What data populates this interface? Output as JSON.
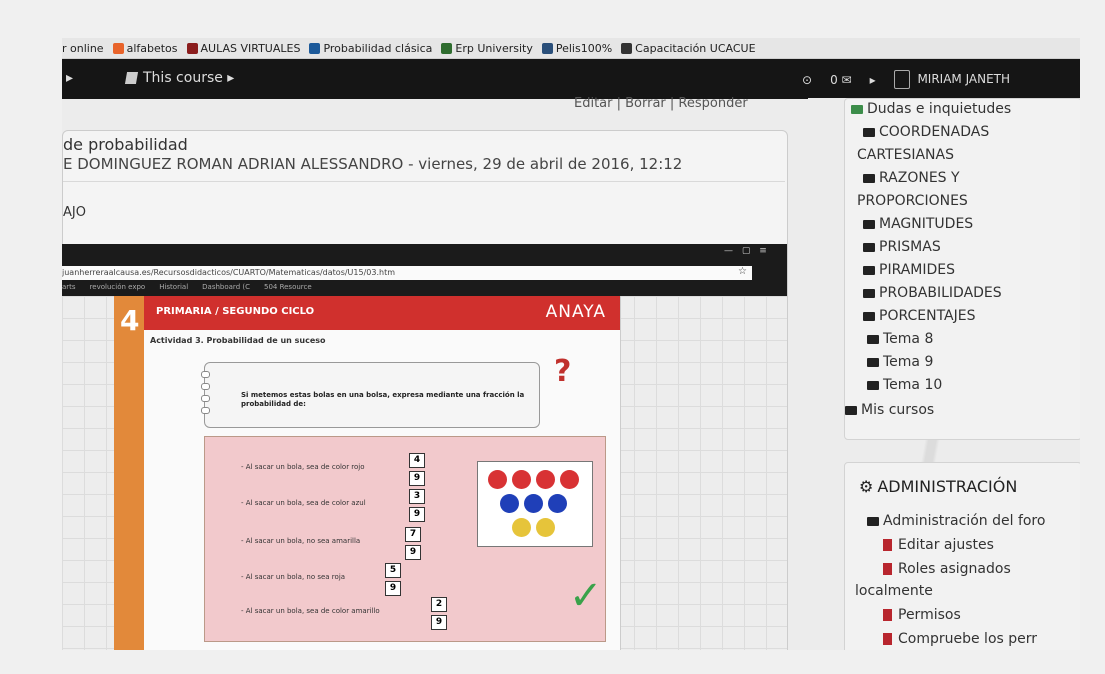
{
  "bookmarks": [
    {
      "label": "r online",
      "icon": "none",
      "color": ""
    },
    {
      "label": "alfabetos",
      "icon": "blogger-icon",
      "color": "#e8632a"
    },
    {
      "label": "AULAS VIRTUALES",
      "icon": "m-logo-icon",
      "color": "#8b1d1d"
    },
    {
      "label": "Probabilidad clásica",
      "icon": "linkedin-icon",
      "color": "#1d5a9a"
    },
    {
      "label": "Erp University",
      "icon": "globe-icon",
      "color": "#2f6d2f"
    },
    {
      "label": "Pelis100%",
      "icon": "tv-icon",
      "color": "#2a4f7a"
    },
    {
      "label": "Capacitación UCACUE",
      "icon": "person-icon",
      "color": "#333333"
    }
  ],
  "topnav": {
    "chevron": "▸",
    "course_label": "This course ▸",
    "power": "⊙",
    "messages": "0 ✉",
    "arrow": "▸",
    "user_name": "MIRIAM JANETH"
  },
  "post": {
    "actions": "Editar | Borrar | Responder",
    "title": "de probabilidad",
    "author_line": "E DOMINGUEZ ROMAN ADRIAN ALESSANDRO - viernes, 29 de abril de 2016, 12:12",
    "body": "AJO"
  },
  "embedded": {
    "url": "juanherreraalcausa.es/Recursosdidacticos/CUARTO/Matematicas/datos/U15/03.htm",
    "bookmarks": [
      "arts",
      "revolución expo",
      "Historial",
      "Dashboard (C",
      "504 Resource"
    ],
    "window_controls": "— ▢ ≡",
    "unit_number": "4",
    "level": "PRIMARIA / SEGUNDO CICLO",
    "brand": "ANAYA",
    "activity_title": "Actividad 3. Probabilidad de un suceso",
    "prompt": "Si metemos estas bolas en una bolsa, expresa mediante una fracción la probabilidad de:",
    "question_mark": "?",
    "checkmark": "✓",
    "rows": [
      {
        "text": "- Al sacar un bola, sea de color rojo",
        "num": "4",
        "den": "9"
      },
      {
        "text": "- Al sacar un bola, sea de color azul",
        "num": "3",
        "den": "9"
      },
      {
        "text": "- Al sacar un bola, no sea amarilla",
        "num": "7",
        "den": "9"
      },
      {
        "text": "- Al sacar un bola, no sea roja",
        "num": "5",
        "den": "9"
      },
      {
        "text": "- Al sacar un bola, sea de color amarillo",
        "num": "2",
        "den": "9"
      }
    ],
    "balls": {
      "red": 4,
      "blue": 3,
      "yellow": 2,
      "red_color": "#d83234",
      "blue_color": "#1f3fb8",
      "yellow_color": "#e6c43a"
    }
  },
  "navigation": {
    "items": [
      {
        "label": "Dudas e inquietudes",
        "icon": "forum-icon"
      },
      {
        "label": "COORDENADAS",
        "icon": "folder-icon"
      },
      {
        "label": "CARTESIANAS",
        "icon": "none"
      },
      {
        "label": "RAZONES Y",
        "icon": "folder-icon"
      },
      {
        "label": "PROPORCIONES",
        "icon": "none"
      },
      {
        "label": "MAGNITUDES",
        "icon": "folder-icon"
      },
      {
        "label": "PRISMAS",
        "icon": "folder-icon"
      },
      {
        "label": "PIRAMIDES",
        "icon": "folder-icon"
      },
      {
        "label": "PROBABILIDADES",
        "icon": "folder-icon"
      },
      {
        "label": "PORCENTAJES",
        "icon": "folder-icon"
      },
      {
        "label": "Tema 8",
        "icon": "folder-icon"
      },
      {
        "label": "Tema 9",
        "icon": "folder-icon"
      },
      {
        "label": "Tema 10",
        "icon": "folder-icon"
      },
      {
        "label": "Mis cursos",
        "icon": "folder-icon"
      }
    ]
  },
  "administration": {
    "title": "ADMINISTRACIÓN",
    "items": [
      {
        "label": "Administración del foro",
        "icon": "folder-open-icon"
      },
      {
        "label": "Editar ajustes",
        "icon": "document-icon"
      },
      {
        "label": "Roles asignados",
        "icon": "document-icon"
      },
      {
        "label": "localmente",
        "icon": "none"
      },
      {
        "label": "Permisos",
        "icon": "document-icon"
      },
      {
        "label": "Compruebe los perr",
        "icon": "document-icon"
      }
    ]
  }
}
